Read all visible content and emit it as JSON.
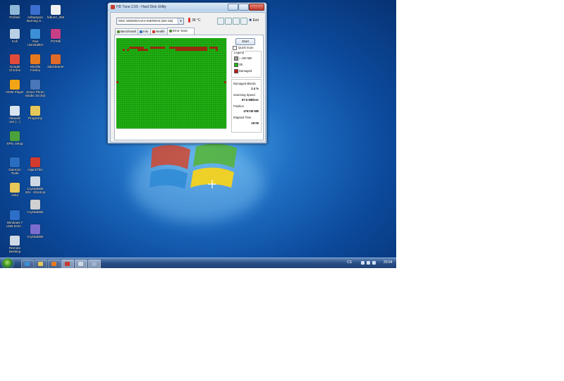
{
  "desktop_icons": [
    {
      "label": "Počítač",
      "color": "#8fb7d8",
      "icon": "computer-icon"
    },
    {
      "label": "Ashampoo\nBurning S...",
      "color": "#3b6fcf",
      "icon": "burning-icon"
    },
    {
      "label": "hdtune_255",
      "color": "#f0f0f0",
      "icon": "installer-icon"
    },
    {
      "label": "Koš",
      "color": "#b9d0e6",
      "icon": "recycle-bin-icon"
    },
    {
      "label": "Your\nUninstaller!",
      "color": "#3a8fd6",
      "icon": "uninstaller-icon"
    },
    {
      "label": "PSTelli",
      "color": "#c83f86",
      "icon": "app-icon"
    },
    {
      "label": "Google\nChrome",
      "color": "#e24b3c",
      "icon": "chrome-icon"
    },
    {
      "label": "Mozilla\nFirefox",
      "color": "#e87a1e",
      "icon": "firefox-icon"
    },
    {
      "label": "adwcleaner",
      "color": "#e06a2a",
      "icon": "adwcleaner-icon"
    },
    {
      "label": "GOM Player",
      "color": "#f2a516",
      "icon": "gom-player-icon"
    },
    {
      "label": "Zoner Photo\nStudio 15 (64)",
      "color": "#4a77b8",
      "icon": "zoner-icon"
    },
    {
      "label": "Aktualiz\nace (...)",
      "color": "#d9e4f1",
      "icon": "document-icon"
    },
    {
      "label": "Programy",
      "color": "#e6c75a",
      "icon": "folder-icon"
    },
    {
      "label": "SPD_setup",
      "color": "#4aa23c",
      "icon": "setup-icon"
    },
    {
      "label": "Daemon\nTools",
      "color": "#2a6ec2",
      "icon": "daemon-icon"
    },
    {
      "label": "HijackThis",
      "color": "#d23a2e",
      "icon": "hijackthis-icon"
    },
    {
      "label": "Vista",
      "color": "#e6c75a",
      "icon": "folder-icon"
    },
    {
      "label": "CrystalDisk\nInfo - Shortcut",
      "color": "#cfd9e6",
      "icon": "crystaldisk-icon"
    },
    {
      "label": "CrystalDisk",
      "color": "#d0d0d0",
      "icon": "crystaldisk-icon"
    },
    {
      "label": "Windows 7\nUSB-DVD...",
      "color": "#2c6ec8",
      "icon": "usb-dvd-icon"
    },
    {
      "label": "CrystalDisk",
      "color": "#7b6ccf",
      "icon": "crystaldisk-icon"
    },
    {
      "label": "Remote\nDesktop",
      "color": "#cfd9e6",
      "icon": "remote-desktop-icon"
    }
  ],
  "window": {
    "title": "HD Tune 2.55 - Hard Disk Utility",
    "drive": "WDC WD5000AAKX-00ERMA0 (500 GB)",
    "temperature": "38 °C",
    "exit_label": "Exit",
    "tabs": [
      {
        "label": "Benchmark",
        "color": "#5a8f3a"
      },
      {
        "label": "Info",
        "color": "#3a6fb8"
      },
      {
        "label": "Health",
        "color": "#d23a2e"
      },
      {
        "label": "Error Scan",
        "color": "#5a8f3a"
      }
    ],
    "start_label": "Start",
    "quick_scan_label": "Quick Scan",
    "legend_label": "Legend",
    "legend_block_size": "= 190 MB",
    "legend_ok": "Ok",
    "legend_damaged": "Damaged",
    "damaged_blocks_label": "Damaged Blocks",
    "damaged_blocks_value": "2.4 %",
    "scanning_speed_label": "Scanning Speed",
    "scanning_speed_value": "87.6 MB/sec",
    "position_label": "Position",
    "position_value": "476749 MB",
    "elapsed_time_label": "Elapsed Time",
    "elapsed_time_value": "18:06"
  },
  "colors": {
    "ok": "#22b814",
    "damaged": "#c0160f",
    "grid_line": "#117008"
  },
  "taskbar": {
    "language": "CS",
    "clock": "20:54",
    "items": [
      "ie-icon",
      "explorer-icon",
      "media-player-icon",
      "hdtune-icon",
      "documents-icon",
      "app-icon"
    ]
  }
}
